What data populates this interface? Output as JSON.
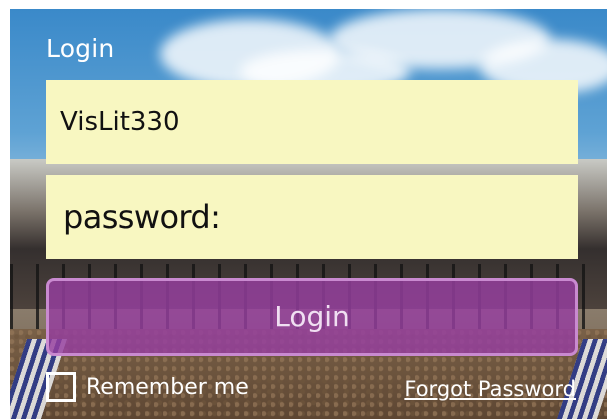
{
  "form": {
    "title": "Login",
    "username": {
      "value": "VisLit330"
    },
    "password": {
      "placeholder": "password:"
    },
    "login_button": "Login",
    "remember_label": "Remember me",
    "remember_checked": false,
    "forgot_link": "Forgot Password"
  },
  "colors": {
    "field_background": "#f8f7c1",
    "button_fill": "#963ea0",
    "button_border": "#c98ad0",
    "label_text": "#ffffff"
  }
}
